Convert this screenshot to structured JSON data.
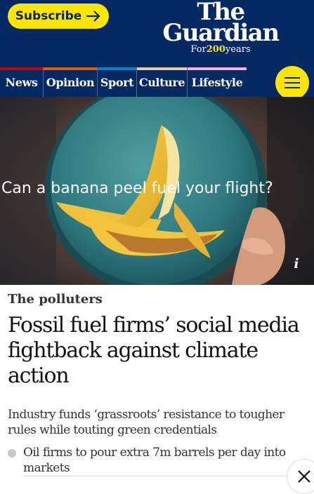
{
  "header": {
    "subscribe_label": "Subscribe",
    "logo_line1": "The",
    "logo_line2": "Guardian",
    "tagline_pre": "For",
    "tagline_num": "200",
    "tagline_post": "years",
    "brand_color": "#052962",
    "accent_color": "#ffe500"
  },
  "nav": {
    "items": [
      {
        "label": "News",
        "color": "#c70000"
      },
      {
        "label": "Opinion",
        "color": "#e05e00"
      },
      {
        "label": "Sport",
        "color": "#0084c6"
      },
      {
        "label": "Culture",
        "color": "#eacca0"
      },
      {
        "label": "Lifestyle",
        "color": "#ffabdb"
      }
    ],
    "menu_icon": "hamburger-menu-icon"
  },
  "hero": {
    "caption": "Can a banana peel fuel your flight?",
    "info_icon": "i"
  },
  "article": {
    "kicker": "The polluters",
    "headline": "Fossil fuel firms’ social media fightback against climate action",
    "standfirst": "Industry funds ‘grassroots’ resistance to tougher rules while touting green credentials",
    "related": [
      {
        "text": "Oil firms to pour extra 7m barrels per day into markets"
      }
    ]
  },
  "overlay": {
    "close_icon": "close-icon"
  }
}
